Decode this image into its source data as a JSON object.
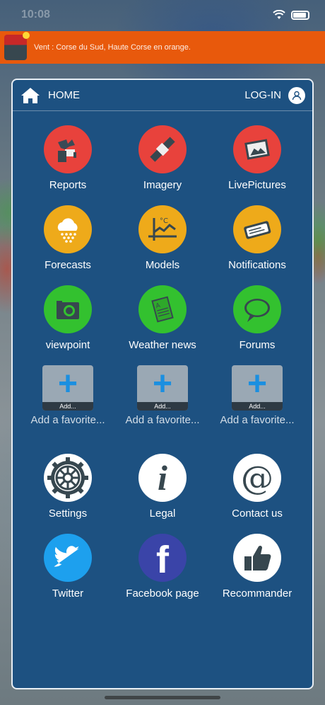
{
  "status_bar": {
    "time": "10:08"
  },
  "alert": {
    "text": "Vent : Corse du Sud, Haute Corse en orange."
  },
  "header": {
    "home_label": "HOME",
    "login_label": "LOG-IN"
  },
  "tiles": [
    {
      "label": "Reports",
      "icon": "reports-icon",
      "color": "#e8423c"
    },
    {
      "label": "Imagery",
      "icon": "satellite-icon",
      "color": "#e8423c"
    },
    {
      "label": "LivePictures",
      "icon": "picture-frame-icon",
      "color": "#e8423c"
    },
    {
      "label": "Forecasts",
      "icon": "rain-cloud-icon",
      "color": "#eeaa1a"
    },
    {
      "label": "Models",
      "icon": "model-chart-icon",
      "color": "#eeaa1a"
    },
    {
      "label": "Notifications",
      "icon": "notification-icon",
      "color": "#eeaa1a"
    },
    {
      "label": "viewpoint",
      "icon": "camera-icon",
      "color": "#33c12f"
    },
    {
      "label": "Weather news",
      "icon": "newspaper-icon",
      "color": "#33c12f"
    },
    {
      "label": "Forums",
      "icon": "speech-bubble-icon",
      "color": "#33c12f"
    }
  ],
  "favorites": [
    {
      "strip": "Add...",
      "label": "Add a favorite..."
    },
    {
      "strip": "Add...",
      "label": "Add a favorite..."
    },
    {
      "strip": "Add...",
      "label": "Add a favorite..."
    }
  ],
  "bottom_tiles": [
    {
      "label": "Settings",
      "icon": "gear-icon"
    },
    {
      "label": "Legal",
      "icon": "info-icon",
      "glyph": "i"
    },
    {
      "label": "Contact us",
      "icon": "at-sign-icon",
      "glyph": "@"
    },
    {
      "label": "Twitter",
      "icon": "twitter-bird-icon",
      "color": "#1da0ee"
    },
    {
      "label": "Facebook page",
      "icon": "facebook-icon",
      "glyph": "f",
      "color": "#3a44a8"
    },
    {
      "label": "Recommander",
      "icon": "thumbs-up-icon"
    }
  ]
}
